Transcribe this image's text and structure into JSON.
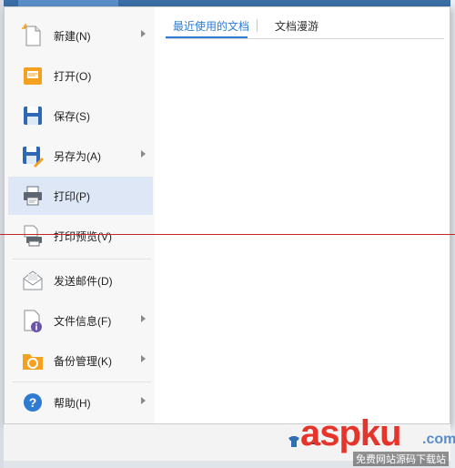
{
  "menu": {
    "items": [
      {
        "label": "新建(N)",
        "icon": "new-doc-icon",
        "has_submenu": true
      },
      {
        "label": "打开(O)",
        "icon": "open-folder-icon",
        "has_submenu": false
      },
      {
        "label": "保存(S)",
        "icon": "save-icon",
        "has_submenu": false
      },
      {
        "label": "另存为(A)",
        "icon": "save-as-icon",
        "has_submenu": true
      },
      {
        "label": "打印(P)",
        "icon": "print-icon",
        "has_submenu": false,
        "selected": true
      },
      {
        "label": "打印预览(V)",
        "icon": "print-preview-icon",
        "has_submenu": false
      },
      {
        "label": "发送邮件(D)",
        "icon": "email-icon",
        "has_submenu": false
      },
      {
        "label": "文件信息(F)",
        "icon": "file-info-icon",
        "has_submenu": true
      },
      {
        "label": "备份管理(K)",
        "icon": "backup-icon",
        "has_submenu": true
      },
      {
        "label": "帮助(H)",
        "icon": "help-icon",
        "has_submenu": true
      }
    ]
  },
  "content": {
    "tabs": [
      {
        "label": "最近使用的文档",
        "active": true
      },
      {
        "label": "文档漫游",
        "active": false
      }
    ]
  },
  "watermark": {
    "brand": "aspku",
    "suffix": ".com",
    "subtitle": "免费网站源码下载站"
  },
  "colors": {
    "accent": "#2f7bd3",
    "selected_bg": "#dde7f5",
    "red_line": "#c0282a",
    "watermark_red": "#e5342a"
  }
}
